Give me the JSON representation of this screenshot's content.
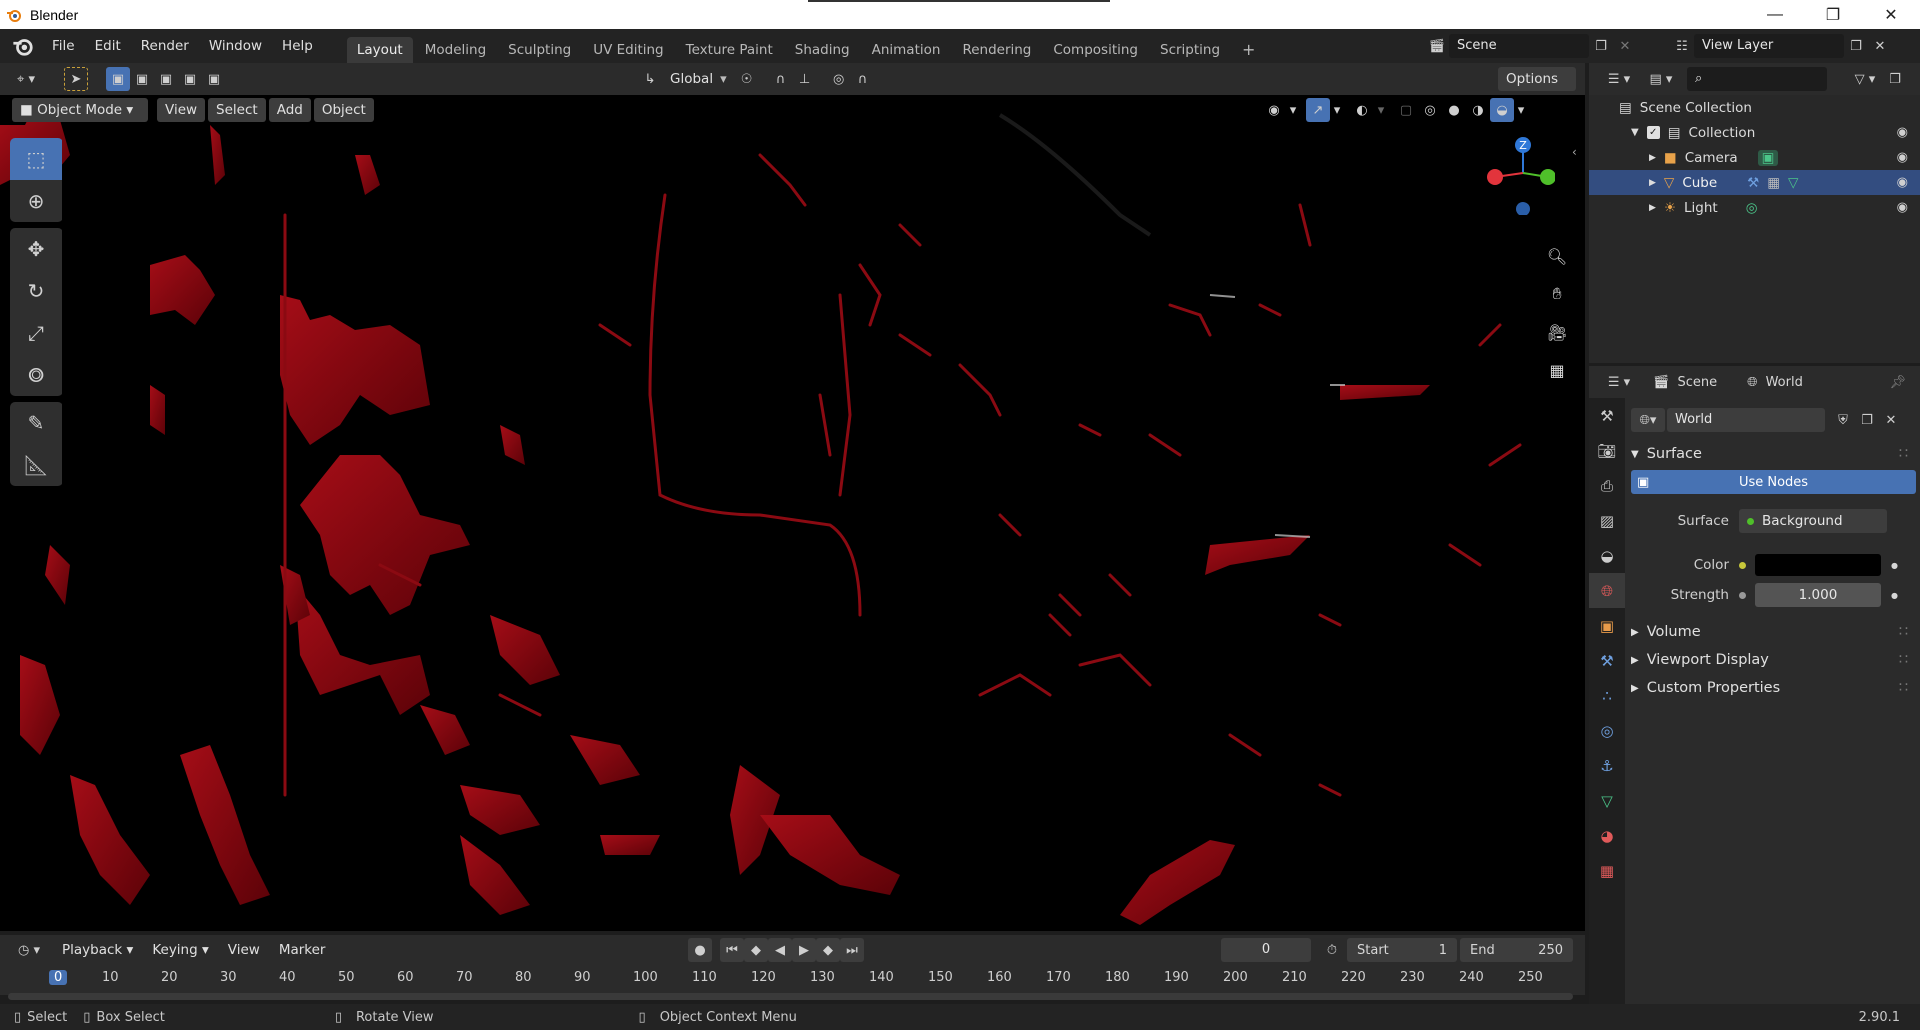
{
  "window": {
    "title": "Blender"
  },
  "menus": [
    "File",
    "Edit",
    "Render",
    "Window",
    "Help"
  ],
  "workspaces": [
    "Layout",
    "Modeling",
    "Sculpting",
    "UV Editing",
    "Texture Paint",
    "Shading",
    "Animation",
    "Rendering",
    "Compositing",
    "Scripting"
  ],
  "active_workspace": "Layout",
  "scene_selector": {
    "label": "Scene"
  },
  "viewlayer_selector": {
    "label": "View Layer"
  },
  "viewport_header": {
    "orientation": "Global",
    "options": "Options",
    "mode": "Object Mode",
    "menus": [
      "View",
      "Select",
      "Add",
      "Object"
    ]
  },
  "gizmo": {
    "z_label": "Z"
  },
  "timeline": {
    "menus": [
      "Playback",
      "Keying",
      "View",
      "Marker"
    ],
    "current_frame": "0",
    "start_label": "Start",
    "start_value": "1",
    "end_label": "End",
    "end_value": "250",
    "ruler": [
      "0",
      "10",
      "20",
      "30",
      "40",
      "50",
      "60",
      "70",
      "80",
      "90",
      "100",
      "110",
      "120",
      "130",
      "140",
      "150",
      "160",
      "170",
      "180",
      "190",
      "200",
      "210",
      "220",
      "230",
      "240",
      "250"
    ]
  },
  "status": {
    "select": "Select",
    "box_select": "Box Select",
    "rotate_view": "Rotate View",
    "context_menu": "Object Context Menu",
    "version": "2.90.1"
  },
  "outliner": {
    "root": "Scene Collection",
    "collection": "Collection",
    "items": [
      {
        "name": "Camera",
        "selected": false
      },
      {
        "name": "Cube",
        "selected": true
      },
      {
        "name": "Light",
        "selected": false
      }
    ]
  },
  "properties": {
    "breadcrumb_scene": "Scene",
    "breadcrumb_world": "World",
    "world_name": "World",
    "panel_surface": "Surface",
    "use_nodes": "Use Nodes",
    "surface_label": "Surface",
    "surface_value": "Background",
    "color_label": "Color",
    "strength_label": "Strength",
    "strength_value": "1.000",
    "panel_volume": "Volume",
    "panel_viewport_display": "Viewport Display",
    "panel_custom_properties": "Custom Properties"
  },
  "colors": {
    "accent": "#4772b3",
    "selected_row": "#334d80",
    "viewport_red": "#8b0a12",
    "gizmo_x": "#e2343c",
    "gizmo_y": "#4fbf2a",
    "gizmo_z": "#2f78d8"
  }
}
